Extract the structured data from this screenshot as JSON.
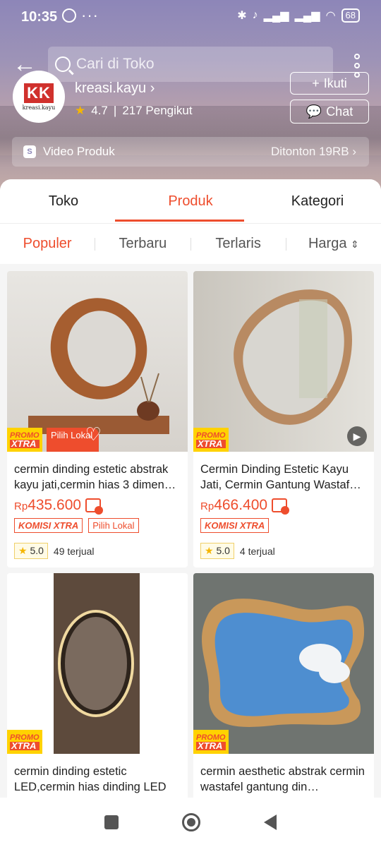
{
  "status_bar": {
    "time": "10:35",
    "battery": "68"
  },
  "header": {
    "search_placeholder": "Cari di Toko",
    "shop_name": "kreasi.kayu",
    "rating": "4.7",
    "followers": "217 Pengikut",
    "follow_label": "Ikuti",
    "chat_label": "Chat",
    "logo_text": "KK",
    "logo_sub": "kreasi.kayu"
  },
  "video_bar": {
    "label": "Video Produk",
    "views": "Ditonton 19RB"
  },
  "tabs": [
    {
      "label": "Toko"
    },
    {
      "label": "Produk",
      "active": true
    },
    {
      "label": "Kategori"
    }
  ],
  "sort": [
    {
      "label": "Populer",
      "active": true
    },
    {
      "label": "Terbaru"
    },
    {
      "label": "Terlaris"
    },
    {
      "label": "Harga"
    }
  ],
  "products": [
    {
      "title": "cermin dinding estetic abstrak kayu jati,cermin hias 3 dimen…",
      "currency": "Rp",
      "price": "435.600",
      "tags": [
        "KOMISI XTRA",
        "Pilih Lokal"
      ],
      "rating": "5.0",
      "sold": "49 terjual",
      "promo": "PROMO",
      "xtra": "XTRA",
      "lokal": "Pilih Lokal"
    },
    {
      "title": "Cermin Dinding Estetic Kayu Jati, Cermin Gantung Wastaf…",
      "currency": "Rp",
      "price": "466.400",
      "tags": [
        "KOMISI XTRA"
      ],
      "rating": "5.0",
      "sold": "4 terjual",
      "promo": "PROMO",
      "xtra": "XTRA"
    },
    {
      "title": "cermin dinding estetic LED,cermin hias dinding LED …",
      "promo": "PROMO",
      "xtra": "XTRA"
    },
    {
      "title": "cermin aesthetic abstrak cermin wastafel gantung din…",
      "promo": "PROMO",
      "xtra": "XTRA"
    }
  ],
  "colors": {
    "accent": "#ee4d2d",
    "star": "#f5b600"
  }
}
